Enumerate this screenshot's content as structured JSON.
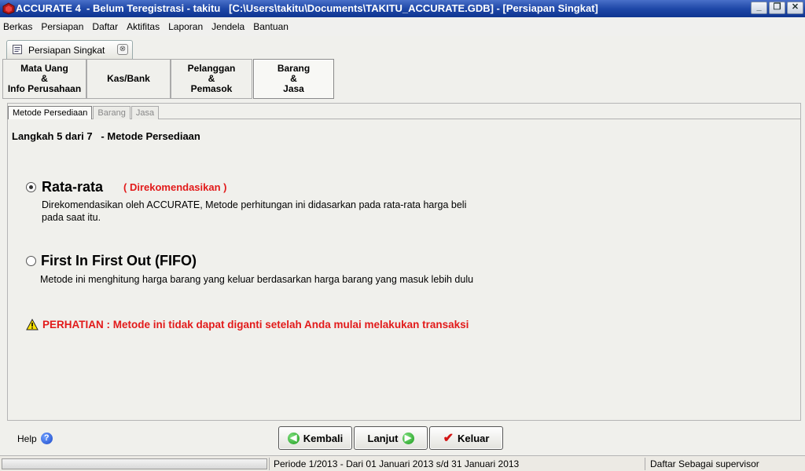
{
  "window": {
    "title": "ACCURATE 4  - Belum Teregistrasi - takitu   [C:\\Users\\takitu\\Documents\\TAKITU_ACCURATE.GDB] - [Persiapan Singkat]",
    "minimize": "_",
    "restore": "❐",
    "close": "✕"
  },
  "menu": [
    "Berkas",
    "Persiapan",
    "Daftar",
    "Aktifitas",
    "Laporan",
    "Jendela",
    "Bantuan"
  ],
  "doc_tab": {
    "label": "Persiapan Singkat",
    "close": "⊗"
  },
  "step_tabs": [
    {
      "label": "Mata Uang\n&\nInfo Perusahaan"
    },
    {
      "label": "Kas/Bank"
    },
    {
      "label": "Pelanggan\n&\nPemasok"
    },
    {
      "label": "Barang\n&\nJasa"
    }
  ],
  "sub_tabs": [
    "Metode Persediaan",
    "Barang",
    "Jasa"
  ],
  "step_heading": "Langkah 5 dari 7   - Metode Persediaan",
  "options": [
    {
      "title": "Rata-rata",
      "recommend": "( Direkomendasikan )",
      "desc": "Direkomendasikan oleh ACCURATE, Metode perhitungan ini didasarkan pada rata-rata harga beli pada saat itu.",
      "checked": true
    },
    {
      "title": "First In First Out (FIFO)",
      "desc": "Metode ini menghitung harga barang yang keluar berdasarkan harga barang yang masuk lebih dulu",
      "checked": false
    }
  ],
  "warning": "PERHATIAN : Metode ini tidak dapat diganti setelah Anda mulai melakukan transaksi",
  "help_label": "Help",
  "buttons": {
    "back": "Kembali",
    "next": "Lanjut",
    "exit": "Keluar"
  },
  "status": {
    "period": "Periode 1/2013 - Dari 01 Januari 2013 s/d 31 Januari 2013",
    "user": "Daftar Sebagai supervisor"
  },
  "colors": {
    "accent_red": "#e21a1a",
    "titlebar": "#1f48a8"
  }
}
